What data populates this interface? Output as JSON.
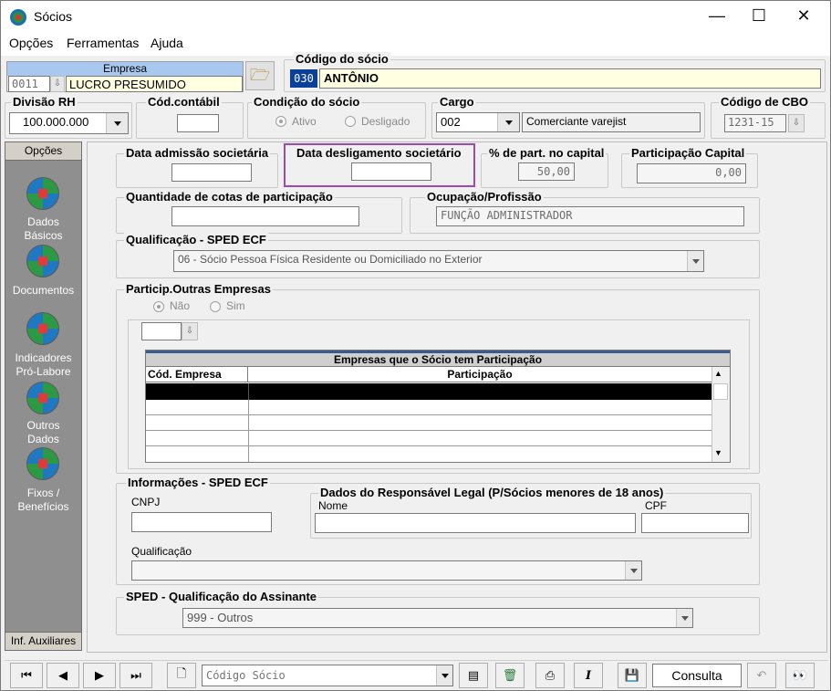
{
  "window": {
    "title": "Sócios",
    "minimize": "—",
    "maximize": "☐",
    "close": "✕"
  },
  "menu": [
    {
      "label": "Opções",
      "accel": "O"
    },
    {
      "label": "Ferramentas",
      "accel": "F"
    },
    {
      "label": "Ajuda",
      "accel": "A"
    }
  ],
  "empresa": {
    "label": "Empresa",
    "code": "0011",
    "name": "LUCRO PRESUMIDO"
  },
  "socio": {
    "label": "Código do sócio",
    "code": "030",
    "name": "ANTÔNIO"
  },
  "divisao": {
    "label": "Divisão RH",
    "value": "100.000.000"
  },
  "cod_contabil": {
    "label": "Cód.contábil",
    "value": ""
  },
  "condicao": {
    "label": "Condição do sócio",
    "ativo": "Ativo",
    "desligado": "Desligado",
    "selected": "Ativo"
  },
  "cargo": {
    "label": "Cargo",
    "code": "002",
    "description": "Comerciante varejist"
  },
  "cbo": {
    "label": "Código de CBO",
    "value": "1231-15"
  },
  "sidebar": {
    "header": "Opções",
    "items": [
      {
        "label": "Dados\nBásicos"
      },
      {
        "label": "Documentos"
      },
      {
        "label": "Indicadores\nPró-Labore"
      },
      {
        "label": "Outros\nDados"
      },
      {
        "label": "Fixos /\nBenefícios"
      }
    ],
    "footer": "Inf. Auxiliares"
  },
  "form": {
    "data_admissao": {
      "label": "Data admissão societária",
      "value": ""
    },
    "data_desligamento": {
      "label": "Data desligamento societário",
      "value": ""
    },
    "perc_capital": {
      "label": "% de part. no capital",
      "value": "50,00"
    },
    "participacao_capital": {
      "label": "Participação Capital",
      "value": "0,00"
    },
    "qtd_cotas": {
      "label": "Quantidade de cotas de participação",
      "value": ""
    },
    "ocupacao": {
      "label": "Ocupação/Profissão",
      "value": "FUNÇÃO ADMINISTRADOR"
    },
    "qualificacao_sped": {
      "label": "Qualificação - SPED ECF",
      "value": "06 - Sócio Pessoa Física Residente ou Domiciliado no Exterior"
    },
    "particip_outras": {
      "label": "Particip.Outras Empresas",
      "nao": "Não",
      "sim": "Sim",
      "selected": "Não"
    },
    "empresas_table": {
      "title": "Empresas que o Sócio tem Participação",
      "columns": [
        "Cód. Empresa",
        "Participação"
      ],
      "rows": [
        [
          "",
          ""
        ],
        [
          "",
          ""
        ],
        [
          "",
          ""
        ],
        [
          "",
          ""
        ]
      ]
    },
    "informacoes": {
      "label": "Informações - SPED ECF",
      "cnpj_label": "CNPJ",
      "cnpj": "",
      "qualificacao_label": "Qualificação",
      "qualificacao": "",
      "responsavel": {
        "label": "Dados do Responsável Legal (P/Sócios menores de 18 anos)",
        "nome_label": "Nome",
        "nome": "",
        "cpf_label": "CPF",
        "cpf": ""
      }
    },
    "assinante": {
      "label": "SPED - Qualificação do Assinante",
      "value": "999 - Outros"
    }
  },
  "toolbar": {
    "search_placeholder": "Código Sócio",
    "status": "Consulta"
  },
  "colors": {
    "highlight_border": "#9b4bb0",
    "selection": "#0a3f9c",
    "field_yellow": "#ffffe1"
  }
}
